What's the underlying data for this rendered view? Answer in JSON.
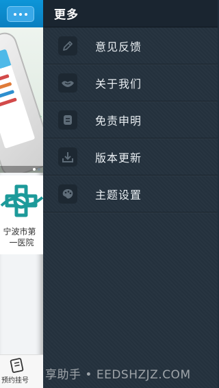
{
  "left_pane": {
    "hospital_name_line1": "宁波市第",
    "hospital_name_line2": "一医院",
    "bottom_tab_label": "预约挂号"
  },
  "menu": {
    "title": "更多",
    "items": [
      {
        "label": "意见反馈",
        "icon": "pencil-icon"
      },
      {
        "label": "关于我们",
        "icon": "handshake-icon"
      },
      {
        "label": "免责申明",
        "icon": "document-icon"
      },
      {
        "label": "版本更新",
        "icon": "download-icon"
      },
      {
        "label": "主题设置",
        "icon": "palette-icon"
      }
    ]
  },
  "watermark": "享助手 • EEDSHZJZ.COM",
  "colors": {
    "menu_background": "#24313d",
    "menu_header": "#1a2530",
    "topbar_blue": "#0d95d8",
    "hospital_logo_teal": "#1d9a9a"
  }
}
